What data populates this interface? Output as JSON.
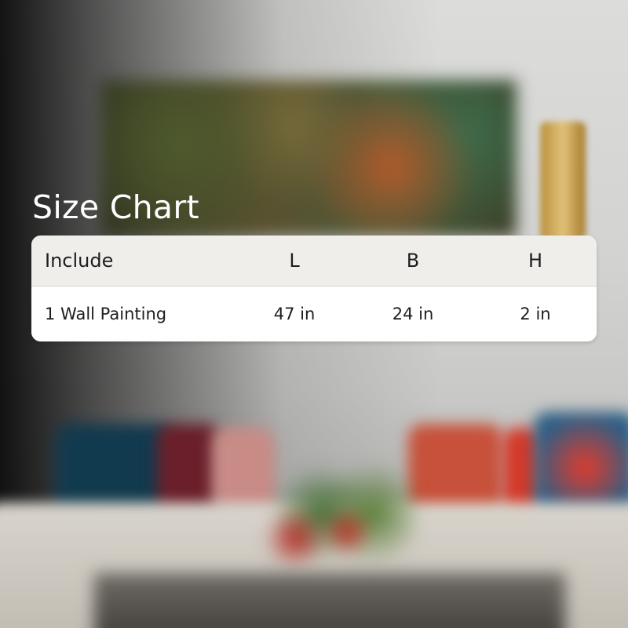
{
  "title": "Size Chart",
  "table": {
    "headers": {
      "include": "Include",
      "l": "L",
      "b": "B",
      "h": "H"
    },
    "rows": [
      {
        "include": "1 Wall Painting",
        "l": "47 in",
        "b": "24 in",
        "h": "2 in"
      }
    ]
  },
  "colors": {
    "header_bg": "#efeeeb",
    "row_bg": "#ffffff",
    "title_text": "#ffffff",
    "cell_text": "#1e1e1e"
  }
}
